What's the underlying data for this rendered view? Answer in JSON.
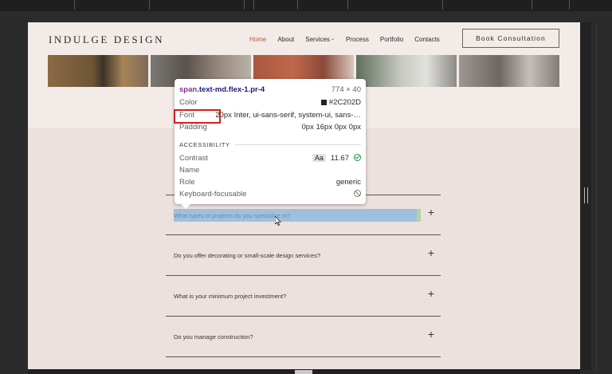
{
  "site": {
    "brand": "INDULGE DESIGN",
    "nav": [
      {
        "label": "Home",
        "active": true
      },
      {
        "label": "About",
        "active": false
      },
      {
        "label": "Services",
        "active": false
      },
      {
        "label": "Process",
        "active": false
      },
      {
        "label": "Portfolio",
        "active": false
      },
      {
        "label": "Contacts",
        "active": false
      }
    ],
    "services_caret": "⌄",
    "cta_label": "Book Consultation",
    "accent_color": "#b5573f"
  },
  "faq": [
    {
      "question": "What types of projects do you specialize in?",
      "highlighted": true
    },
    {
      "question": "Do you offer decorating or small-scale design services?",
      "highlighted": false
    },
    {
      "question": "What is your minimum project investment?",
      "highlighted": false
    },
    {
      "question": "Do you manage construction?",
      "highlighted": false
    }
  ],
  "faq_plus": "+",
  "inspector": {
    "selector_tag": "span",
    "selector_class": ".text-md.flex-1.pr-4",
    "dimensions": "774 × 40",
    "color_label": "Color",
    "color_value": "#2C202D",
    "font_label": "Font",
    "font_value": "20px Inter, ui-sans-serif, system-ui, sans-…",
    "padding_label": "Padding",
    "padding_value": "0px 16px 0px 0px",
    "accessibility_title": "ACCESSIBILITY",
    "contrast_label": "Contrast",
    "contrast_badge": "Aa",
    "contrast_value": "11.67",
    "name_label": "Name",
    "name_value": "",
    "role_label": "Role",
    "role_value": "generic",
    "keyboard_label": "Keyboard-focusable"
  }
}
